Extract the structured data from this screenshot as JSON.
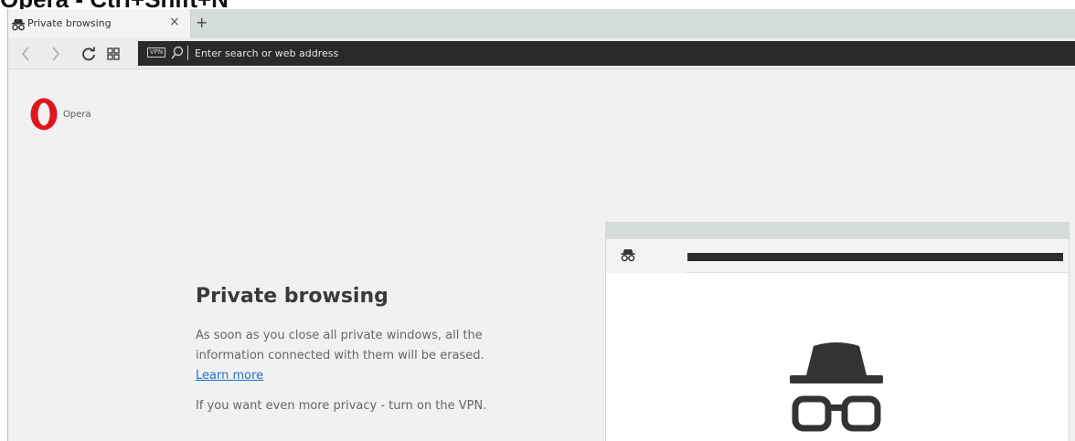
{
  "caption": "Opera - Ctrl+Shift+N",
  "tab": {
    "icon": "incognito-icon",
    "title": "Private browsing",
    "close_label": "×",
    "new_tab_label": "+"
  },
  "navbar": {
    "icons": [
      "back-icon",
      "forward-icon",
      "reload-icon",
      "speed-dial-icon"
    ],
    "vpn_label": "VPN",
    "search_icon": "search-icon",
    "address_placeholder": "Enter search or web address"
  },
  "brand": {
    "logo": "opera-logo",
    "name": "Opera"
  },
  "main": {
    "heading": "Private browsing",
    "description": "As soon as you close all private windows, all the information connected with them will be erased.",
    "learn_more": "Learn more",
    "vpn_note": "If you want even more privacy - turn on the VPN."
  },
  "preview": {
    "tab_icon": "incognito-icon",
    "illustration": "incognito-illustration-icon"
  },
  "colors": {
    "page_bg": "#f1f1f1",
    "tabstrip_bg": "#d4dcdc",
    "addressbar_bg": "#2a2a2a",
    "opera_red": "#e0161e",
    "link": "#1a73c9"
  }
}
